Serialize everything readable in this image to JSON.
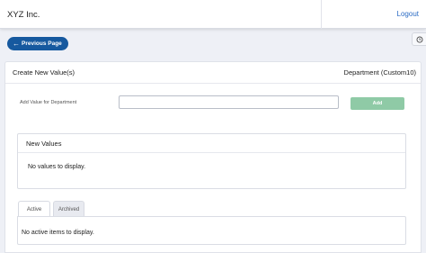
{
  "header": {
    "company": "XYZ Inc.",
    "logout": "Logout"
  },
  "help": {
    "icon": "clock-icon"
  },
  "nav": {
    "previous_page": "Previous Page",
    "previous_icon": "arrow-left-icon"
  },
  "panel": {
    "title": "Create New Value(s)",
    "department": "Department (Custom10)",
    "field_label": "Add Value for Department",
    "input_value": "",
    "input_placeholder": "",
    "add_button": "Add",
    "add_button_color": "#8fcaa6"
  },
  "new_values": {
    "title": "New Values",
    "empty_message": "No values to display."
  },
  "tabs": [
    {
      "label": "Active",
      "selected": true
    },
    {
      "label": "Archived",
      "selected": false
    }
  ],
  "tab_content": {
    "empty_message": "No active items to display."
  },
  "colors": {
    "primary": "#16599f",
    "background": "#eef0f6"
  }
}
